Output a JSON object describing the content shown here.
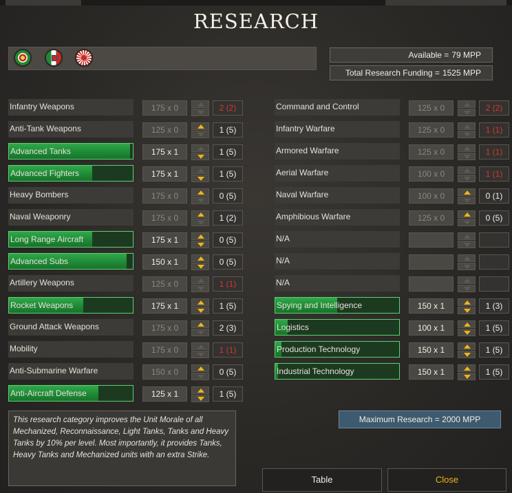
{
  "title": "RESEARCH",
  "nations": [
    {
      "icon": "portugal-flag-icon"
    },
    {
      "icon": "italy-flag-icon"
    },
    {
      "icon": "japan-flag-icon"
    }
  ],
  "available": {
    "label": "Available =",
    "value": "79 MPP"
  },
  "funding": {
    "label": "Total Research Funding =",
    "value": "1525 MPP"
  },
  "left_column": [
    {
      "name": "Infantry Weapons",
      "progress": 0,
      "investment": "175 x 0",
      "up": false,
      "down": false,
      "level": "2 (2)",
      "maxed": true
    },
    {
      "name": "Anti-Tank Weapons",
      "progress": 0,
      "investment": "125 x 0",
      "up": true,
      "down": false,
      "level": "1 (5)",
      "maxed": false
    },
    {
      "name": "Advanced Tanks",
      "progress": 0.98,
      "investment": "175 x 1",
      "up": false,
      "down": true,
      "level": "1 (5)",
      "maxed": false
    },
    {
      "name": "Advanced Fighters",
      "progress": 0.67,
      "investment": "175 x 1",
      "up": false,
      "down": true,
      "level": "1 (5)",
      "maxed": false
    },
    {
      "name": "Heavy Bombers",
      "progress": 0,
      "investment": "175 x 0",
      "up": true,
      "down": false,
      "level": "0 (5)",
      "maxed": false
    },
    {
      "name": "Naval Weaponry",
      "progress": 0,
      "investment": "175 x 0",
      "up": true,
      "down": false,
      "level": "1 (2)",
      "maxed": false
    },
    {
      "name": "Long Range Aircraft",
      "progress": 0.67,
      "investment": "175 x 1",
      "up": true,
      "down": true,
      "level": "0 (5)",
      "maxed": false
    },
    {
      "name": "Advanced Subs",
      "progress": 0.95,
      "investment": "150 x 1",
      "up": true,
      "down": true,
      "level": "0 (5)",
      "maxed": false
    },
    {
      "name": "Artillery Weapons",
      "progress": 0,
      "investment": "125 x 0",
      "up": false,
      "down": false,
      "level": "1 (1)",
      "maxed": true
    },
    {
      "name": "Rocket Weapons",
      "progress": 0.6,
      "investment": "175 x 1",
      "up": true,
      "down": true,
      "level": "1 (5)",
      "maxed": false
    },
    {
      "name": "Ground Attack Weapons",
      "progress": 0,
      "investment": "175 x 0",
      "up": true,
      "down": false,
      "level": "2 (3)",
      "maxed": false
    },
    {
      "name": "Mobility",
      "progress": 0,
      "investment": "175 x 0",
      "up": false,
      "down": false,
      "level": "1 (1)",
      "maxed": true
    },
    {
      "name": "Anti-Submarine Warfare",
      "progress": 0,
      "investment": "150 x 0",
      "up": true,
      "down": false,
      "level": "0 (5)",
      "maxed": false
    },
    {
      "name": "Anti-Aircraft Defense",
      "progress": 0.72,
      "investment": "125 x 1",
      "up": true,
      "down": true,
      "level": "1 (5)",
      "maxed": false
    }
  ],
  "right_column": [
    {
      "name": "Command and Control",
      "progress": 0,
      "investment": "125 x 0",
      "up": false,
      "down": false,
      "level": "2 (2)",
      "maxed": true
    },
    {
      "name": "Infantry Warfare",
      "progress": 0,
      "investment": "125 x 0",
      "up": false,
      "down": false,
      "level": "1 (1)",
      "maxed": true
    },
    {
      "name": "Armored Warfare",
      "progress": 0,
      "investment": "125 x 0",
      "up": false,
      "down": false,
      "level": "1 (1)",
      "maxed": true
    },
    {
      "name": "Aerial Warfare",
      "progress": 0,
      "investment": "100 x 0",
      "up": false,
      "down": false,
      "level": "1 (1)",
      "maxed": true
    },
    {
      "name": "Naval Warfare",
      "progress": 0,
      "investment": "100 x 0",
      "up": true,
      "down": false,
      "level": "0 (1)",
      "maxed": false
    },
    {
      "name": "Amphibious Warfare",
      "progress": 0,
      "investment": "125 x 0",
      "up": true,
      "down": false,
      "level": "0 (5)",
      "maxed": false
    },
    {
      "name": "N/A",
      "progress": 0,
      "investment": "",
      "up": false,
      "down": false,
      "level": "",
      "maxed": false
    },
    {
      "name": "N/A",
      "progress": 0,
      "investment": "",
      "up": false,
      "down": false,
      "level": "",
      "maxed": false
    },
    {
      "name": "N/A",
      "progress": 0,
      "investment": "",
      "up": false,
      "down": false,
      "level": "",
      "maxed": false
    },
    {
      "name": "Spying and Intelligence",
      "progress": 0.5,
      "investment": "150 x 1",
      "up": true,
      "down": true,
      "level": "1 (3)",
      "maxed": false
    },
    {
      "name": "Logistics",
      "progress": 0.1,
      "investment": "100 x 1",
      "up": true,
      "down": true,
      "level": "1 (5)",
      "maxed": false
    },
    {
      "name": "Production Technology",
      "progress": 0.05,
      "investment": "150 x 1",
      "up": true,
      "down": true,
      "level": "1 (5)",
      "maxed": false
    },
    {
      "name": "Industrial Technology",
      "progress": 0.02,
      "investment": "150 x 1",
      "up": true,
      "down": true,
      "level": "1 (5)",
      "maxed": false
    }
  ],
  "description": "This research category improves the Unit Morale of all Mechanized, Reconnaissance, Light Tanks, Tanks and Heavy Tanks by 10% per level. Most importantly, it provides Tanks, Heavy Tanks and Mechanized units with an extra Strike.",
  "max_research": {
    "label": "Maximum Research =",
    "value": "2000 MPP"
  },
  "buttons": {
    "table": "Table",
    "close": "Close"
  },
  "colors": {
    "accent": "#f0b418",
    "progress": "#2fa84a",
    "maxed_level": "#d03a2c",
    "max_box": "#3d5a6e"
  }
}
